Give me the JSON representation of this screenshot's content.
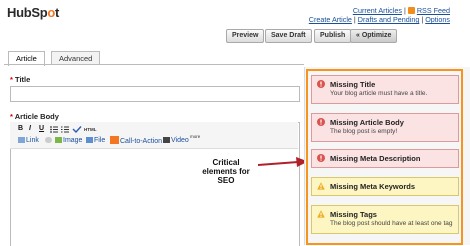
{
  "logo": {
    "text_a": "HubSp",
    "text_b": "o",
    "text_c": "t"
  },
  "top_links": {
    "current_articles": "Current Articles",
    "rss_feed": "RSS Feed",
    "create_article": "Create Article",
    "drafts_pending": "Drafts and Pending",
    "options": "Options",
    "separator": "|"
  },
  "buttons": {
    "preview": "Preview",
    "save_draft": "Save Draft",
    "publish": "Publish",
    "optimize": "« Optimize"
  },
  "tabs": {
    "article": "Article",
    "advanced": "Advanced"
  },
  "form": {
    "required_marker": "*",
    "title_label": "Title",
    "body_label": "Article Body"
  },
  "toolbar": {
    "bold": "B",
    "italic": "I",
    "underline": "U",
    "html": "HTML",
    "link": "Link",
    "image": "Image",
    "file": "File",
    "cta": "Call-to-Action",
    "video": "Video",
    "more": "more"
  },
  "annotation": {
    "line1": "Critical",
    "line2": "elements for",
    "line3": "SEO"
  },
  "seo_checks": [
    {
      "title": "Missing Title",
      "desc": "Your blog article must have a title.",
      "severity": "error"
    },
    {
      "title": "Missing Article Body",
      "desc": "The blog post is empty!",
      "severity": "error"
    },
    {
      "title": "Missing Meta Description",
      "desc": "",
      "severity": "error"
    },
    {
      "title": "Missing Meta Keywords",
      "desc": "",
      "severity": "warning"
    },
    {
      "title": "Missing Tags",
      "desc": "The blog post should have at least one tag",
      "severity": "warning"
    }
  ],
  "colors": {
    "highlight": "#f7941d",
    "arrow": "#b0212a",
    "error_bg": "#fbe3e3",
    "warning_bg": "#fdf6c3"
  }
}
